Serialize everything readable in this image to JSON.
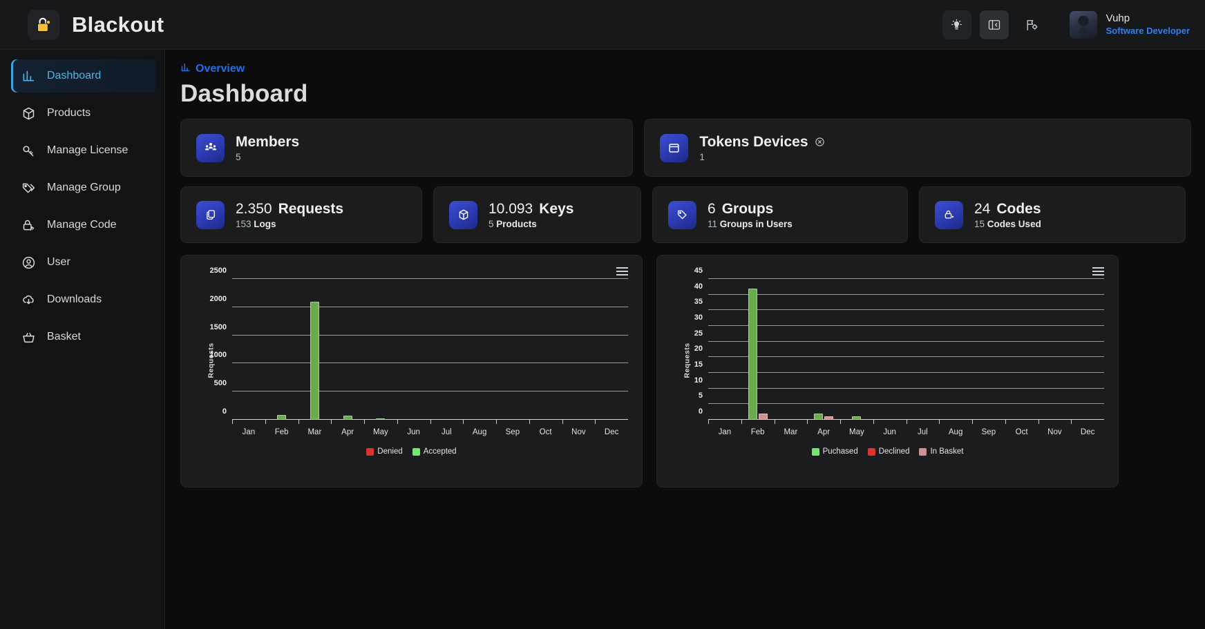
{
  "brand": {
    "name": "Blackout",
    "logo_icon": "padlock-icon"
  },
  "header": {
    "actions": [
      {
        "name": "theme-toggle-button",
        "icon": "lightbulb-icon"
      },
      {
        "name": "sidebar-toggle-button",
        "icon": "panel-collapse-icon"
      },
      {
        "name": "flag-settings-button",
        "icon": "flag-gear-icon"
      }
    ],
    "user": {
      "name": "Vuhp",
      "role": "Software Developer"
    }
  },
  "sidebar": {
    "items": [
      {
        "label": "Dashboard",
        "icon": "bar-chart-icon",
        "selected": true
      },
      {
        "label": "Products",
        "icon": "box-icon",
        "selected": false
      },
      {
        "label": "Manage License",
        "icon": "key-icon",
        "selected": false
      },
      {
        "label": "Manage Group",
        "icon": "tags-icon",
        "selected": false
      },
      {
        "label": "Manage Code",
        "icon": "lock-code-icon",
        "selected": false
      },
      {
        "label": "User",
        "icon": "user-circle-icon",
        "selected": false
      },
      {
        "label": "Downloads",
        "icon": "cloud-download-icon",
        "selected": false
      },
      {
        "label": "Basket",
        "icon": "basket-icon",
        "selected": false
      }
    ]
  },
  "page": {
    "breadcrumb": "Overview",
    "breadcrumb_icon": "bar-chart-icon",
    "title": "Dashboard"
  },
  "stats": {
    "members": {
      "title": "Members",
      "value": "5",
      "icon": "members-icon"
    },
    "tokens": {
      "title": "Tokens Devices",
      "value": "1",
      "icon": "window-icon",
      "badge_icon": "circle-x-icon"
    },
    "requests": {
      "number": "2.350",
      "label": "Requests",
      "sub_value": "153",
      "sub_label": "Logs",
      "icon": "copy-icon"
    },
    "keys": {
      "number": "10.093",
      "label": "Keys",
      "sub_value": "5",
      "sub_label": "Products",
      "icon": "box-icon"
    },
    "groups": {
      "number": "6",
      "label": "Groups",
      "sub_value": "11",
      "sub_label": "Groups in Users",
      "icon": "tag-icon"
    },
    "codes": {
      "number": "24",
      "label": "Codes",
      "sub_value": "15",
      "sub_label": "Codes Used",
      "icon": "lock-code-icon"
    }
  },
  "colors": {
    "accent_blue": "#1f6feb",
    "sidebar_active": "#4db5e8",
    "green": "#6aab4f",
    "legend_green": "#6ee86e",
    "red": "#d9352d",
    "pink": "#cf8f90"
  },
  "chart_data": [
    {
      "type": "bar",
      "id": "requests-chart",
      "title": "",
      "xlabel": "",
      "ylabel": "Requests",
      "categories": [
        "Jan",
        "Feb",
        "Mar",
        "Apr",
        "May",
        "Jun",
        "Jul",
        "Aug",
        "Sep",
        "Oct",
        "Nov",
        "Dec"
      ],
      "yticks": [
        0,
        500,
        1000,
        1500,
        2000,
        2500
      ],
      "ylim": [
        0,
        2500
      ],
      "grid": true,
      "legend_position": "bottom",
      "series": [
        {
          "name": "Denied",
          "color": "#d9352d",
          "values": [
            0,
            0,
            0,
            0,
            0,
            0,
            0,
            0,
            0,
            0,
            0,
            0
          ]
        },
        {
          "name": "Accepted",
          "color": "#6aab4f",
          "values": [
            0,
            80,
            2100,
            70,
            10,
            0,
            0,
            0,
            0,
            0,
            0,
            0
          ]
        }
      ],
      "menu_icon": "hamburger-menu-icon"
    },
    {
      "type": "bar",
      "id": "purchases-chart",
      "title": "",
      "xlabel": "",
      "ylabel": "Requests",
      "categories": [
        "Jan",
        "Feb",
        "Mar",
        "Apr",
        "May",
        "Jun",
        "Jul",
        "Aug",
        "Sep",
        "Oct",
        "Nov",
        "Dec"
      ],
      "yticks": [
        0,
        5,
        10,
        15,
        20,
        25,
        30,
        35,
        40,
        45
      ],
      "ylim": [
        0,
        45
      ],
      "grid": true,
      "legend_position": "bottom",
      "series": [
        {
          "name": "Puchased",
          "color": "#6aab4f",
          "values": [
            0,
            42,
            0,
            2,
            1,
            0,
            0,
            0,
            0,
            0,
            0,
            0
          ]
        },
        {
          "name": "Declined",
          "color": "#d9352d",
          "values": [
            0,
            0,
            0,
            0,
            0,
            0,
            0,
            0,
            0,
            0,
            0,
            0
          ]
        },
        {
          "name": "In Basket",
          "color": "#cf8f90",
          "values": [
            0,
            2,
            0,
            1,
            0,
            0,
            0,
            0,
            0,
            0,
            0,
            0
          ]
        }
      ],
      "menu_icon": "hamburger-menu-icon"
    }
  ]
}
